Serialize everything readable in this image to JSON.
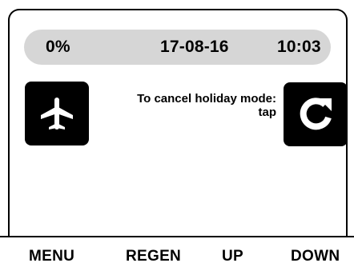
{
  "status": {
    "percent": "0%",
    "date": "17-08-16",
    "time": "10:03"
  },
  "message": {
    "line1": "To cancel holiday mode:",
    "line2": "tap"
  },
  "icons": {
    "holiday": "airplane-icon",
    "cancel": "refresh-icon"
  },
  "nav": {
    "menu": "MENU",
    "regen": "REGEN",
    "up": "UP",
    "down": "DOWN"
  },
  "colors": {
    "status_bar": "#d6d6d6",
    "buttons": "#000000",
    "background": "#ffffff"
  }
}
